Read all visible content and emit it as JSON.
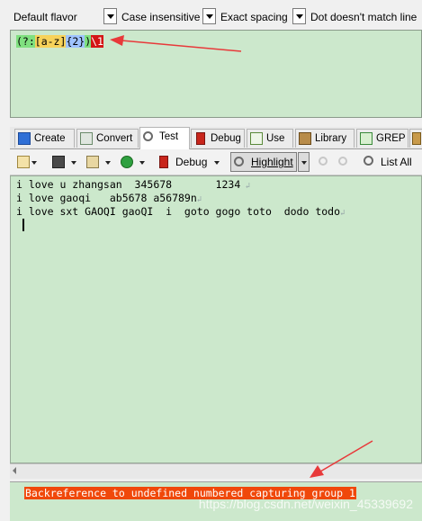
{
  "options": {
    "flavor": "Default flavor",
    "case": "Case insensitive",
    "spacing": "Exact spacing",
    "dot": "Dot doesn't match line"
  },
  "regex": {
    "open_group": "(?:",
    "char_class": "[a-z]",
    "quantifier": "{2}",
    "close_group": ")",
    "backref": "\\1"
  },
  "tabs": [
    {
      "label": "Create"
    },
    {
      "label": "Convert"
    },
    {
      "label": "Test"
    },
    {
      "label": "Debug"
    },
    {
      "label": "Use"
    },
    {
      "label": "Library"
    },
    {
      "label": "GREP"
    }
  ],
  "toolbar": {
    "debug_label": "Debug",
    "highlight_label": "Highlight",
    "list_all_label": "List All"
  },
  "subject_lines": [
    "i love u zhangsan  345678       1234",
    "i love gaoqi   ab5678 a56789n",
    "i love sxt GAOQI gaoQI  i  goto gogo toto  dodo todo"
  ],
  "status": {
    "message": "Backreference to undefined numbered capturing group 1",
    "watermark": "https://blog.csdn.net/weixin_45339692"
  },
  "colors": {
    "pane_bg": "#cce8cc",
    "error_bg": "#f0480a",
    "arrow": "#e8393a"
  }
}
